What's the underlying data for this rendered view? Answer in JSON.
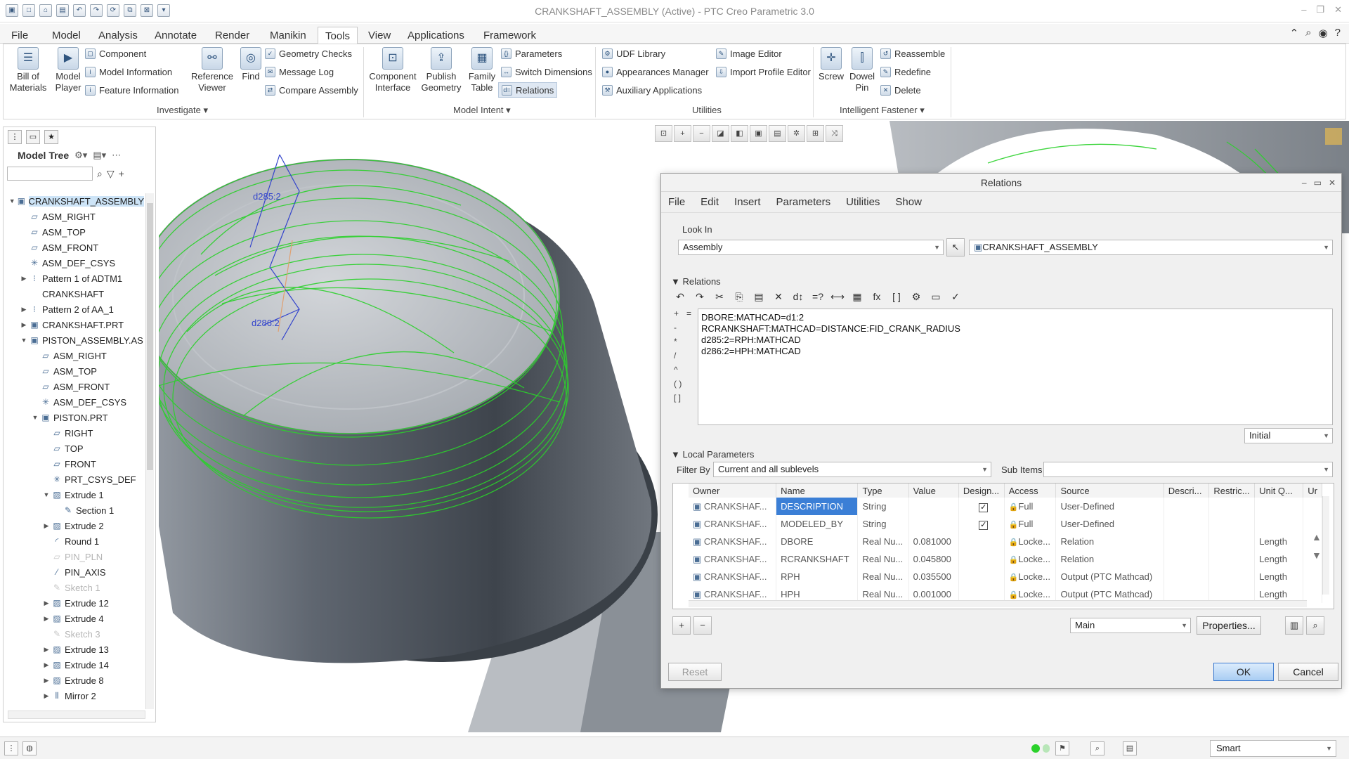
{
  "window": {
    "title": "CRANKSHAFT_ASSEMBLY (Active) - PTC Creo Parametric 3.0"
  },
  "ribbon_tabs": [
    "File",
    "Model",
    "Analysis",
    "Annotate",
    "Render",
    "Manikin",
    "Tools",
    "View",
    "Applications",
    "Framework"
  ],
  "ribbon": {
    "investigate": {
      "bill_of_materials": "Bill of\nMaterials",
      "model_player": "Model\nPlayer",
      "component": "Component",
      "model_information": "Model Information",
      "feature_information": "Feature Information",
      "reference_viewer": "Reference\nViewer",
      "find": "Find",
      "geometry_checks": "Geometry Checks",
      "message_log": "Message Log",
      "compare_assembly": "Compare Assembly",
      "label": "Investigate"
    },
    "model_intent": {
      "component_interface": "Component\nInterface",
      "publish_geometry": "Publish\nGeometry",
      "family_table": "Family\nTable",
      "parameters": "Parameters",
      "switch_dimensions": "Switch Dimensions",
      "relations": "Relations",
      "label": "Model Intent"
    },
    "utilities": {
      "udf_library": "UDF Library",
      "appearances_manager": "Appearances Manager",
      "auxiliary_applications": "Auxiliary Applications",
      "image_editor": "Image Editor",
      "import_profile_editor": "Import Profile Editor",
      "label": "Utilities"
    },
    "intelligent_fastener": {
      "screw": "Screw",
      "dowel_pin": "Dowel\nPin",
      "reassemble": "Reassemble",
      "redefine": "Redefine",
      "delete": "Delete",
      "label": "Intelligent Fastener"
    }
  },
  "model_tree": {
    "header": "Model Tree",
    "items": [
      {
        "label": "CRANKSHAFT_ASSEMBLY",
        "indent": 0,
        "expand": "open",
        "icon": "asm",
        "selected": true
      },
      {
        "label": "ASM_RIGHT",
        "indent": 1,
        "expand": "",
        "icon": "plane"
      },
      {
        "label": "ASM_TOP",
        "indent": 1,
        "expand": "",
        "icon": "plane"
      },
      {
        "label": "ASM_FRONT",
        "indent": 1,
        "expand": "",
        "icon": "plane"
      },
      {
        "label": "ASM_DEF_CSYS",
        "indent": 1,
        "expand": "",
        "icon": "csys"
      },
      {
        "label": "Pattern 1 of ADTM1",
        "indent": 1,
        "expand": "closed",
        "icon": "pattern"
      },
      {
        "label": "CRANKSHAFT",
        "indent": 1,
        "expand": "",
        "icon": "none"
      },
      {
        "label": "Pattern 2 of AA_1",
        "indent": 1,
        "expand": "closed",
        "icon": "pattern"
      },
      {
        "label": "CRANKSHAFT.PRT",
        "indent": 1,
        "expand": "closed",
        "icon": "part"
      },
      {
        "label": "PISTON_ASSEMBLY.AS",
        "indent": 1,
        "expand": "open",
        "icon": "asm"
      },
      {
        "label": "ASM_RIGHT",
        "indent": 2,
        "expand": "",
        "icon": "plane"
      },
      {
        "label": "ASM_TOP",
        "indent": 2,
        "expand": "",
        "icon": "plane"
      },
      {
        "label": "ASM_FRONT",
        "indent": 2,
        "expand": "",
        "icon": "plane"
      },
      {
        "label": "ASM_DEF_CSYS",
        "indent": 2,
        "expand": "",
        "icon": "csys"
      },
      {
        "label": "PISTON.PRT",
        "indent": 2,
        "expand": "open",
        "icon": "part"
      },
      {
        "label": "RIGHT",
        "indent": 3,
        "expand": "",
        "icon": "plane"
      },
      {
        "label": "TOP",
        "indent": 3,
        "expand": "",
        "icon": "plane"
      },
      {
        "label": "FRONT",
        "indent": 3,
        "expand": "",
        "icon": "plane"
      },
      {
        "label": "PRT_CSYS_DEF",
        "indent": 3,
        "expand": "",
        "icon": "csys"
      },
      {
        "label": "Extrude 1",
        "indent": 3,
        "expand": "open",
        "icon": "extrude"
      },
      {
        "label": "Section 1",
        "indent": 4,
        "expand": "",
        "icon": "sketch"
      },
      {
        "label": "Extrude 2",
        "indent": 3,
        "expand": "closed",
        "icon": "extrude"
      },
      {
        "label": "Round 1",
        "indent": 3,
        "expand": "",
        "icon": "round"
      },
      {
        "label": "PIN_PLN",
        "indent": 3,
        "expand": "",
        "icon": "plane",
        "dim": true
      },
      {
        "label": "PIN_AXIS",
        "indent": 3,
        "expand": "",
        "icon": "axis"
      },
      {
        "label": "Sketch 1",
        "indent": 3,
        "expand": "",
        "icon": "sketch",
        "dim": true
      },
      {
        "label": "Extrude 12",
        "indent": 3,
        "expand": "closed",
        "icon": "extrude"
      },
      {
        "label": "Extrude 4",
        "indent": 3,
        "expand": "closed",
        "icon": "extrude"
      },
      {
        "label": "Sketch 3",
        "indent": 3,
        "expand": "",
        "icon": "sketch",
        "dim": true
      },
      {
        "label": "Extrude 13",
        "indent": 3,
        "expand": "closed",
        "icon": "extrude"
      },
      {
        "label": "Extrude 14",
        "indent": 3,
        "expand": "closed",
        "icon": "extrude"
      },
      {
        "label": "Extrude 8",
        "indent": 3,
        "expand": "closed",
        "icon": "extrude"
      },
      {
        "label": "Mirror 2",
        "indent": 3,
        "expand": "closed",
        "icon": "mirror"
      }
    ]
  },
  "graphics": {
    "dim_labels": [
      "d285:2",
      "d286:2"
    ]
  },
  "dialog": {
    "title": "Relations",
    "menu": [
      "File",
      "Edit",
      "Insert",
      "Parameters",
      "Utilities",
      "Show"
    ],
    "look_in_label": "Look In",
    "look_in_type": "Assembly",
    "look_in_model": "CRANKSHAFT_ASSEMBLY",
    "relations_label": "Relations",
    "relations_lines": [
      "DBORE:MATHCAD=d1:2",
      "RCRANKSHAFT:MATHCAD=DISTANCE:FID_CRANK_RADIUS",
      "d285:2=RPH:MATHCAD",
      "d286:2=HPH:MATHCAD"
    ],
    "relations_ops": [
      "+",
      "=",
      "-",
      "*",
      "/",
      "^",
      "( )",
      "[ ]"
    ],
    "initial_combo": "Initial",
    "local_params_label": "Local Parameters",
    "filter_by_label": "Filter By",
    "filter_by_value": "Current and all sublevels",
    "sub_items_label": "Sub Items",
    "columns": [
      "Owner",
      "Name",
      "Type",
      "Value",
      "Design...",
      "Access",
      "Source",
      "Descri...",
      "Restric...",
      "Unit Q...",
      "Ur"
    ],
    "rows": [
      {
        "owner": "CRANKSHAF...",
        "name": "DESCRIPTION",
        "type": "String",
        "value": "",
        "designate": true,
        "access": "Full",
        "source": "User-Defined",
        "unit": ""
      },
      {
        "owner": "CRANKSHAF...",
        "name": "MODELED_BY",
        "type": "String",
        "value": "",
        "designate": true,
        "access": "Full",
        "source": "User-Defined",
        "unit": ""
      },
      {
        "owner": "CRANKSHAF...",
        "name": "DBORE",
        "type": "Real Nu...",
        "value": "0.081000",
        "designate": false,
        "access": "Locke...",
        "source": "Relation",
        "unit": "Length"
      },
      {
        "owner": "CRANKSHAF...",
        "name": "RCRANKSHAFT",
        "type": "Real Nu...",
        "value": "0.045800",
        "designate": false,
        "access": "Locke...",
        "source": "Relation",
        "unit": "Length"
      },
      {
        "owner": "CRANKSHAF...",
        "name": "RPH",
        "type": "Real Nu...",
        "value": "0.035500",
        "designate": false,
        "access": "Locke...",
        "source": "Output (PTC Mathcad)",
        "unit": "Length"
      },
      {
        "owner": "CRANKSHAF...",
        "name": "HPH",
        "type": "Real Nu...",
        "value": "0.001000",
        "designate": false,
        "access": "Locke...",
        "source": "Output (PTC Mathcad)",
        "unit": "Length"
      }
    ],
    "main_combo": "Main",
    "properties_button": "Properties...",
    "reset_button": "Reset",
    "ok_button": "OK",
    "cancel_button": "Cancel"
  },
  "statusbar": {
    "selection_filter": "Smart"
  },
  "colors": {
    "accent": "#3b7fd6",
    "selection_green": "#2bd12b",
    "dim_blue": "#3344cc"
  }
}
